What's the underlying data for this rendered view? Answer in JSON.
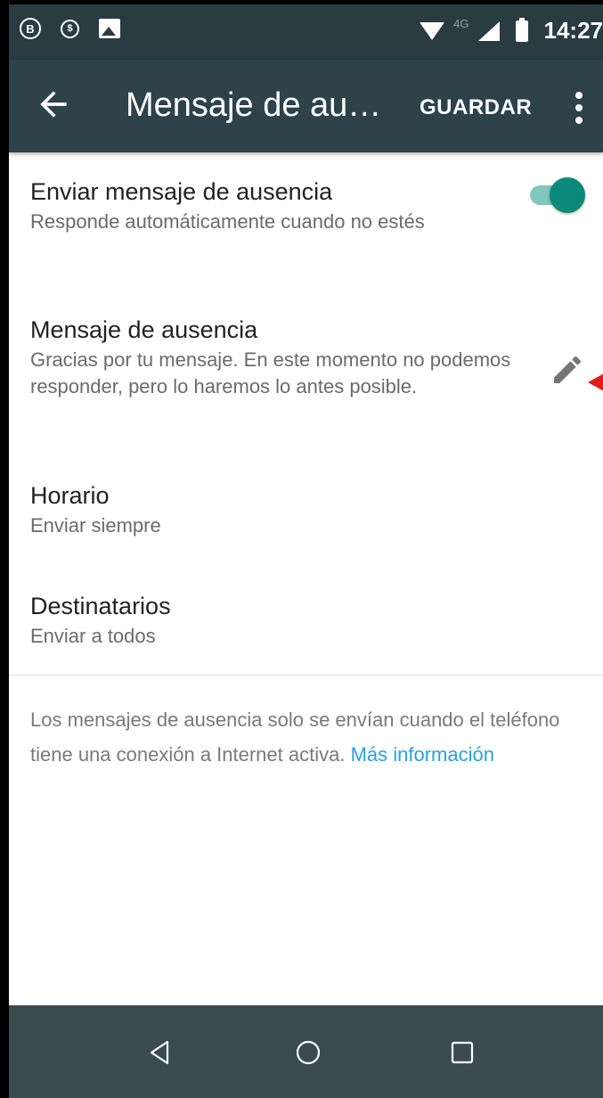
{
  "status_bar": {
    "icon_b": "B",
    "icon_dollar": "$",
    "network_label": "4G",
    "time": "14:27",
    "icons": [
      "whatsapp-business-icon",
      "money-icon",
      "image-icon",
      "wifi-icon",
      "signal-icon",
      "battery-icon"
    ]
  },
  "app_bar": {
    "back_icon": "arrow-left-icon",
    "title": "Mensaje de au…",
    "save_label": "GUARDAR",
    "more_icon": "more-vert-icon"
  },
  "settings": {
    "send_away": {
      "title": "Enviar mensaje de ausencia",
      "subtitle": "Responde automáticamente cuando no estés",
      "enabled": true
    },
    "away_message": {
      "title": "Mensaje de ausencia",
      "subtitle": "Gracias por tu mensaje. En este momento no podemos responder, pero lo haremos lo antes posible.",
      "edit_icon": "pencil-icon"
    },
    "schedule": {
      "title": "Horario",
      "subtitle": "Enviar siempre"
    },
    "recipients": {
      "title": "Destinatarios",
      "subtitle": "Enviar a todos"
    }
  },
  "footer": {
    "text": "Los mensajes de ausencia solo se envían cuando el teléfono tiene una conexión a Internet activa. ",
    "link": "Más información"
  },
  "nav_bar": {
    "icons": [
      "back-triangle-icon",
      "home-circle-icon",
      "recents-square-icon"
    ]
  },
  "colors": {
    "status_bar": "#2a3b42",
    "app_bar": "#2d4249",
    "accent": "#0b8a7b",
    "toggle_track": "#82c7bd",
    "link": "#27a0e6",
    "annotation_arrow": "#e31b1b"
  }
}
